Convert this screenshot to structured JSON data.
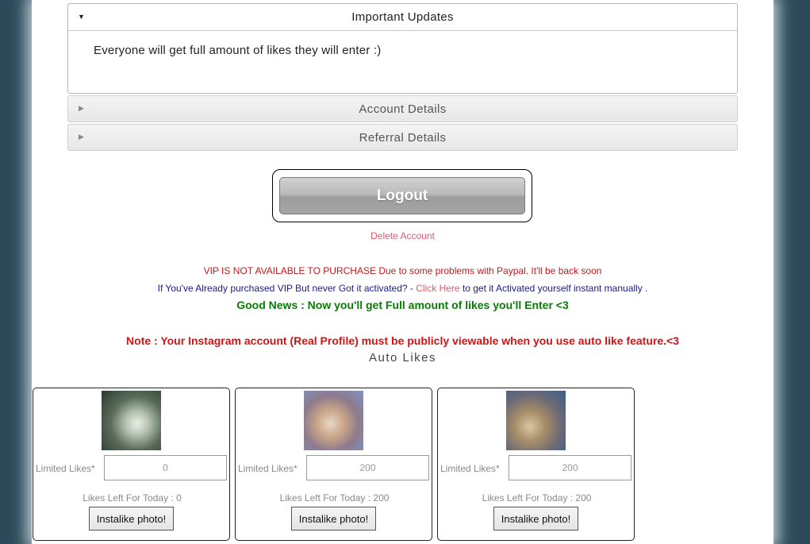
{
  "accordion": {
    "updates": {
      "title": "Important Updates",
      "body": "Everyone will get full amount of likes they will enter :)"
    },
    "account": {
      "title": "Account Details"
    },
    "referral": {
      "title": "Referral Details"
    }
  },
  "icons": {
    "expanded": "triangle-down-icon",
    "collapsed": "triangle-right-icon"
  },
  "actions": {
    "logout_label": "Logout",
    "delete_label": "Delete Account"
  },
  "notices": {
    "vip": "VIP IS NOT AVAILABLE TO PURCHASE Due to some problems with Paypal. It'll be back soon",
    "activation_prefix": "If You've Already purchased VIP But never Got it activated? - ",
    "activation_link": "Click Here",
    "activation_suffix": " to get it Activated yourself instant manually .",
    "good_news": "Good News : Now you'll get Full amount of likes you'll Enter <3",
    "note": "Note : Your Instagram account (Real Profile) must be publicly viewable when you use auto like feature.<3",
    "auto_likes_heading": "Auto Likes"
  },
  "colors": {
    "vip_red": "#c81818",
    "link_pink": "#e05a6e",
    "activation_blue": "#1a1a8c",
    "good_green": "#0a7a0a",
    "page_bg": "#2c4a5a"
  },
  "cards": [
    {
      "limit_label": "Limited Likes*",
      "limit_value": "0",
      "left_today": "Likes Left For Today : 0",
      "button": "Instalike photo!"
    },
    {
      "limit_label": "Limited Likes*",
      "limit_value": "200",
      "left_today": "Likes Left For Today : 200",
      "button": "Instalike photo!"
    },
    {
      "limit_label": "Limited Likes*",
      "limit_value": "200",
      "left_today": "Likes Left For Today : 200",
      "button": "Instalike photo!"
    }
  ]
}
